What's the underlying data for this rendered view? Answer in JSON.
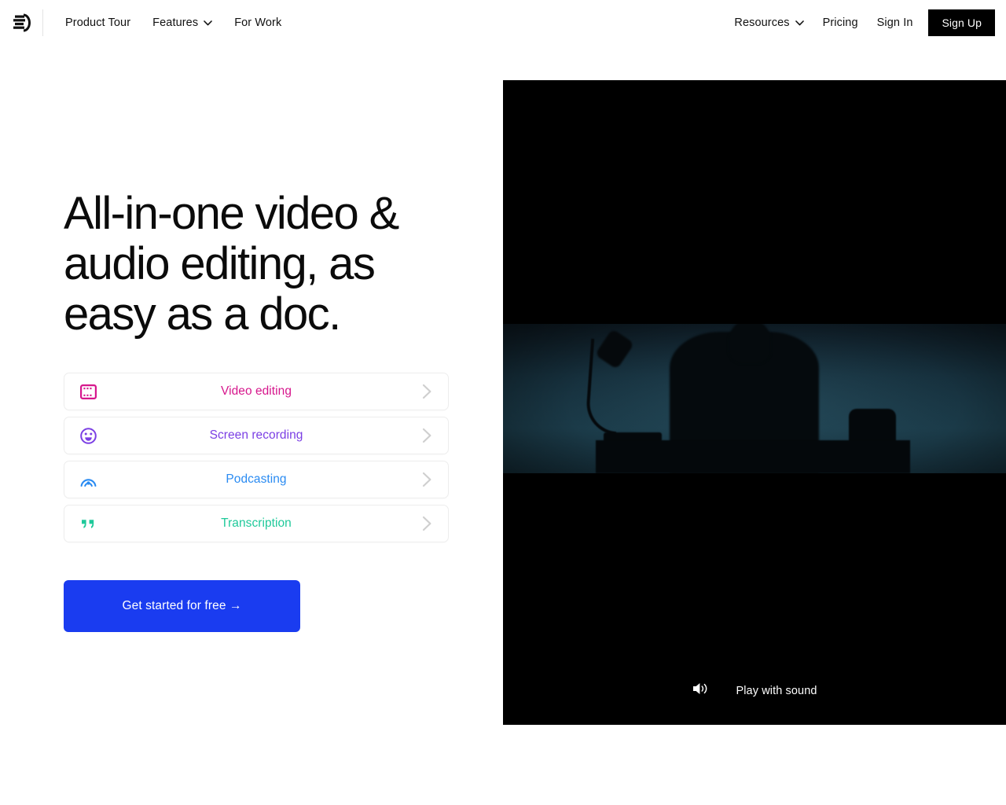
{
  "header": {
    "logo_name": "descript-logo",
    "nav_left": [
      {
        "label": "Product Tour",
        "icon": null
      },
      {
        "label": "Features",
        "icon": "chevron-down-icon"
      },
      {
        "label": "For Work",
        "icon": null
      }
    ],
    "nav_right": [
      {
        "label": "Resources",
        "icon": "chevron-down-icon"
      },
      {
        "label": "Pricing",
        "icon": null
      },
      {
        "label": "Sign In",
        "icon": null
      }
    ],
    "signup_label": "Sign Up",
    "signup_bg": "#000000"
  },
  "hero": {
    "headline": "All-in-one video & audio editing, as easy as a doc.",
    "cta_label": "Get started for free →",
    "cta_bg": "#1a3cf0"
  },
  "cards": [
    {
      "label": "Video editing",
      "color": "#d6168c",
      "icon": "film-strip-icon"
    },
    {
      "label": "Screen recording",
      "color": "#7b3fe4",
      "icon": "smiley-face-icon"
    },
    {
      "label": "Podcasting",
      "color": "#2a8bf2",
      "icon": "broadcast-icon"
    },
    {
      "label": "Transcription",
      "color": "#1fc99a",
      "icon": "quote-marks-icon"
    }
  ],
  "video": {
    "play_label": "Play with sound",
    "speaker_icon": "speaker-sound-icon",
    "background": "#000000"
  }
}
